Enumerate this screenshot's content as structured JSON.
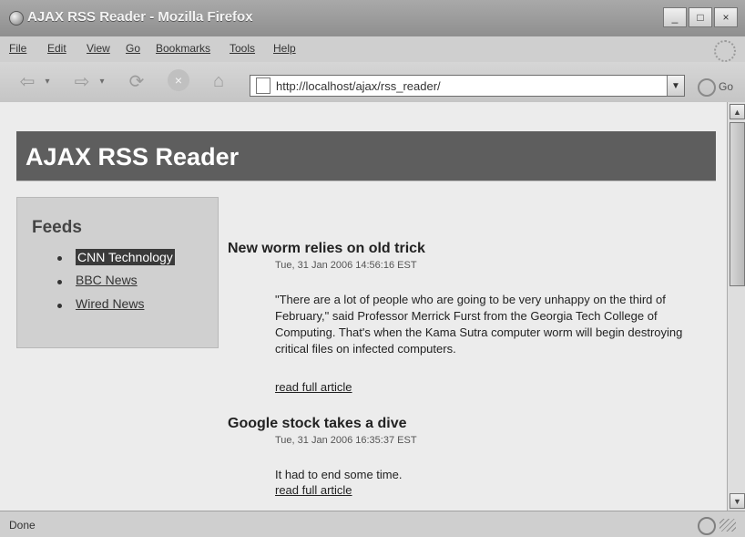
{
  "window": {
    "title": "AJAX RSS Reader - Mozilla Firefox"
  },
  "menu": [
    "File",
    "Edit",
    "View",
    "Go",
    "Bookmarks",
    "Tools",
    "Help"
  ],
  "address_bar": {
    "url": "http://localhost/ajax/rss_reader/",
    "go_label": "Go"
  },
  "page": {
    "header_title": "AJAX RSS Reader",
    "feeds_title": "Feeds",
    "feeds": [
      {
        "label": "CNN Technology",
        "active": true
      },
      {
        "label": "BBC News",
        "active": false
      },
      {
        "label": "Wired News",
        "active": false
      }
    ],
    "articles": [
      {
        "title": "New worm relies on old trick",
        "date": "Tue, 31 Jan 2006 14:56:16 EST",
        "body": "\"There are a lot of people who are going to be very unhappy on the third of February,\" said Professor Merrick Furst from the Georgia Tech College of Computing. That's when the Kama Sutra computer worm will begin destroying critical files on infected computers.",
        "read_more": "read full article"
      },
      {
        "title": "Google stock takes a dive",
        "date": "Tue, 31 Jan 2006 16:35:37 EST",
        "body": "It had to end some time.",
        "read_more": "read full article"
      }
    ]
  },
  "status": {
    "text": "Done"
  },
  "icons": {
    "back": "back-arrow-icon",
    "forward": "forward-arrow-icon",
    "reload": "reload-icon",
    "stop": "stop-icon",
    "home": "home-icon",
    "page": "page-icon",
    "go": "go-icon"
  }
}
